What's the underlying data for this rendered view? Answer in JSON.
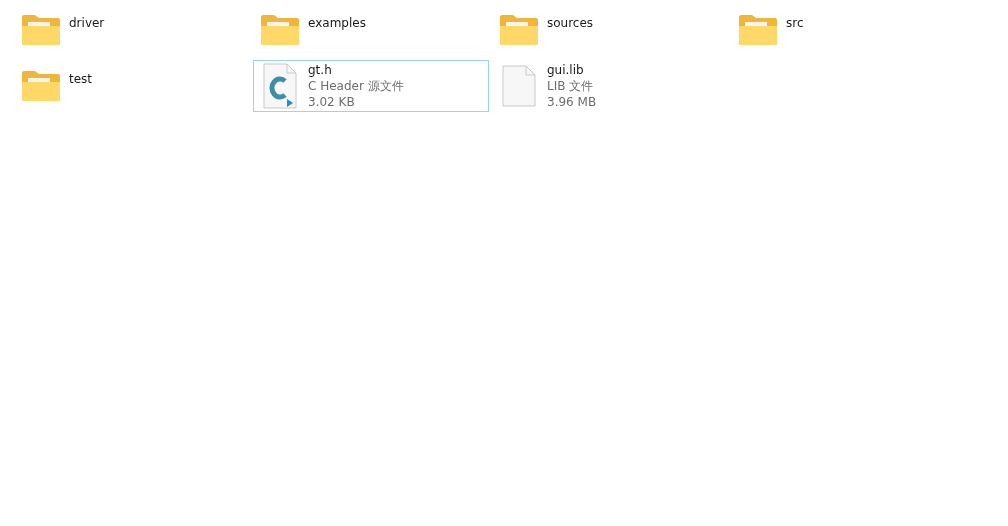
{
  "items": [
    {
      "kind": "folder",
      "name": "driver",
      "selected": false
    },
    {
      "kind": "folder",
      "name": "examples",
      "selected": false
    },
    {
      "kind": "folder",
      "name": "sources",
      "selected": false
    },
    {
      "kind": "folder",
      "name": "src",
      "selected": false
    },
    {
      "kind": "folder",
      "name": "test",
      "selected": false
    },
    {
      "kind": "c-file",
      "name": "gt.h",
      "type": "C Header 源文件",
      "size": "3.02 KB",
      "selected": true
    },
    {
      "kind": "file",
      "name": "gui.lib",
      "type": "LIB 文件",
      "size": "3.96 MB",
      "selected": false
    }
  ]
}
